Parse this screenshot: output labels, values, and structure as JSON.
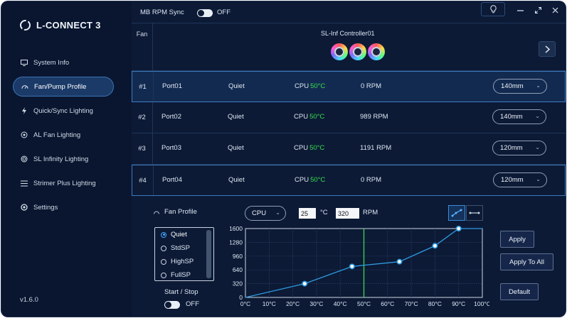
{
  "app": {
    "name": "L-CONNECT 3",
    "version": "v1.6.0"
  },
  "sidebar": {
    "items": [
      {
        "label": "System Info",
        "icon": "monitor-icon"
      },
      {
        "label": "Fan/Pump Profile",
        "icon": "fan-gauge-icon",
        "active": true
      },
      {
        "label": "Quick/Sync Lighting",
        "icon": "bolt-icon"
      },
      {
        "label": "AL Fan Lighting",
        "icon": "fan-lighting-icon"
      },
      {
        "label": "SL Infinity Lighting",
        "icon": "infinity-lighting-icon"
      },
      {
        "label": "Strimer Plus Lighting",
        "icon": "strimer-icon"
      },
      {
        "label": "Settings",
        "icon": "gear-icon"
      }
    ]
  },
  "topbar": {
    "sync_label": "MB RPM Sync",
    "sync_state": "OFF"
  },
  "table": {
    "fan_header": "Fan",
    "controller": "SL-Inf Controller01",
    "rows": [
      {
        "num": "#1",
        "port": "Port01",
        "mode": "Quiet",
        "cpu_label": "CPU",
        "temp": "50°C",
        "rpm": "0 RPM",
        "size": "140mm",
        "selected": true
      },
      {
        "num": "#2",
        "port": "Port02",
        "mode": "Quiet",
        "cpu_label": "CPU",
        "temp": "50°C",
        "rpm": "989 RPM",
        "size": "140mm"
      },
      {
        "num": "#3",
        "port": "Port03",
        "mode": "Quiet",
        "cpu_label": "CPU",
        "temp": "50°C",
        "rpm": "1191 RPM",
        "size": "120mm"
      },
      {
        "num": "#4",
        "port": "Port04",
        "mode": "Quiet",
        "cpu_label": "CPU",
        "temp": "50°C",
        "rpm": "0 RPM",
        "size": "120mm"
      }
    ]
  },
  "profile": {
    "label": "Fan Profile",
    "options": [
      "Quiet",
      "StdSP",
      "HighSP",
      "FullSP"
    ],
    "selected": "Quiet",
    "start_stop_label": "Start / Stop",
    "start_stop_state": "OFF",
    "source": "CPU",
    "temp_value": "25",
    "temp_unit": "°C",
    "rpm_value": "320",
    "rpm_unit": "RPM"
  },
  "chart_data": {
    "type": "line",
    "x": [
      0,
      25,
      45,
      65,
      80,
      90,
      100
    ],
    "y": [
      0,
      320,
      720,
      830,
      1200,
      1600,
      1600
    ],
    "control_points": [
      [
        25,
        320
      ],
      [
        45,
        720
      ],
      [
        65,
        830
      ],
      [
        80,
        1200
      ],
      [
        90,
        1600
      ]
    ],
    "xticks": [
      "0°C",
      "10°C",
      "20°C",
      "30°C",
      "40°C",
      "50°C",
      "60°C",
      "70°C",
      "80°C",
      "90°C",
      "100°C"
    ],
    "yticks": [
      "0",
      "320",
      "640",
      "960",
      "1280",
      "1600"
    ],
    "xlim": [
      0,
      100
    ],
    "ylim": [
      0,
      1600
    ],
    "current_temp_marker": 50,
    "grid": true,
    "line_color": "#2f9be0",
    "marker_color": "#35d04a"
  },
  "actions": {
    "apply": "Apply",
    "apply_all": "Apply To All",
    "default": "Default"
  }
}
